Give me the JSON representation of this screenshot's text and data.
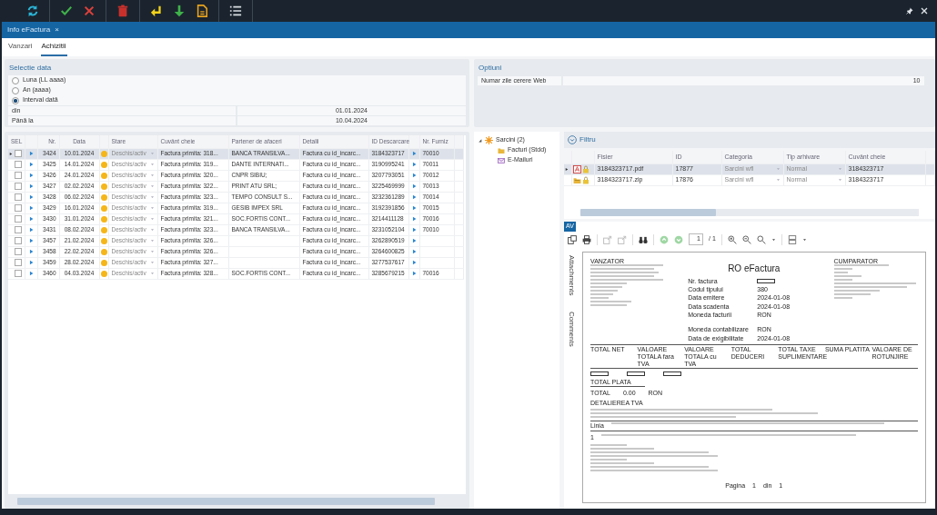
{
  "toolbar": {
    "groups": [
      [
        {
          "kind": "refresh"
        }
      ],
      [
        {
          "kind": "confirm"
        },
        {
          "kind": "cancel"
        }
      ],
      [
        {
          "kind": "delete"
        }
      ],
      [
        {
          "kind": "enter"
        },
        {
          "kind": "download"
        },
        {
          "kind": "document"
        }
      ],
      [
        {
          "kind": "list"
        }
      ]
    ]
  },
  "window_controls": [
    {
      "kind": "pin"
    },
    {
      "kind": "close"
    }
  ],
  "window": {
    "title": "Info eFactura",
    "close": "×"
  },
  "tabs": [
    {
      "label": "Vanzari",
      "selected": false
    },
    {
      "label": "Achizitii",
      "selected": true
    }
  ],
  "date_selection": {
    "title": "Selectie data",
    "options": [
      {
        "label": "Luna (LL aaaa)",
        "selected": false
      },
      {
        "label": "An (aaaa)",
        "selected": false
      },
      {
        "label": "Interval dată",
        "selected": true
      }
    ],
    "fields": [
      {
        "label": "din",
        "value": "01.01.2024"
      },
      {
        "label": "Până la",
        "value": "10.04.2024"
      }
    ]
  },
  "options": {
    "title": "Optiuni",
    "fields": [
      {
        "label": "Numar zile cerere Web",
        "value": "10"
      }
    ]
  },
  "invoices": {
    "columns": [
      "SEL",
      "Nr.",
      "Data",
      "Stare",
      "Cuvânt cheie",
      "Partener de afaceri",
      "Detalii",
      "ID Descarcare",
      "Nr. Furniz"
    ],
    "rows": [
      {
        "selected": true,
        "checked": false,
        "nr": "3424",
        "date": "10.01.2024",
        "status": "Deschis/activ",
        "keyword": "Factura primita: 318...",
        "partner": "BANCA TRANSILVA...",
        "details": "Factura cu id_incarc...",
        "download_id": "3184323717",
        "supplier_nr": "70010"
      },
      {
        "selected": false,
        "checked": false,
        "nr": "3425",
        "date": "14.01.2024",
        "status": "Deschis/activ",
        "keyword": "Factura primita: 319...",
        "partner": "DANTE INTERNATI...",
        "details": "Factura cu id_incarc...",
        "download_id": "3190995241",
        "supplier_nr": "70011"
      },
      {
        "selected": false,
        "checked": false,
        "nr": "3426",
        "date": "24.01.2024",
        "status": "Deschis/activ",
        "keyword": "Factura primita: 320...",
        "partner": "CNPR SIBIU;",
        "details": "Factura cu id_incarc...",
        "download_id": "3207793051",
        "supplier_nr": "70012"
      },
      {
        "selected": false,
        "checked": false,
        "nr": "3427",
        "date": "02.02.2024",
        "status": "Deschis/activ",
        "keyword": "Factura primita: 322...",
        "partner": "PRINT ATU SRL;",
        "details": "Factura cu id_incarc...",
        "download_id": "3225469999",
        "supplier_nr": "70013"
      },
      {
        "selected": false,
        "checked": false,
        "nr": "3428",
        "date": "06.02.2024",
        "status": "Deschis/activ",
        "keyword": "Factura primita: 323...",
        "partner": "TEMPO CONSULT S...",
        "details": "Factura cu id_incarc...",
        "download_id": "3232361289",
        "supplier_nr": "70014"
      },
      {
        "selected": false,
        "checked": false,
        "nr": "3429",
        "date": "16.01.2024",
        "status": "Deschis/activ",
        "keyword": "Factura primita: 319...",
        "partner": "GESIB IMPEX SRL",
        "details": "Factura cu id_incarc...",
        "download_id": "3192391856",
        "supplier_nr": "70015"
      },
      {
        "selected": false,
        "checked": false,
        "nr": "3430",
        "date": "31.01.2024",
        "status": "Deschis/activ",
        "keyword": "Factura primita: 321...",
        "partner": "SOC.FORTIS CONT...",
        "details": "Factura cu id_incarc...",
        "download_id": "3214411128",
        "supplier_nr": "70016"
      },
      {
        "selected": false,
        "checked": false,
        "nr": "3431",
        "date": "08.02.2024",
        "status": "Deschis/activ",
        "keyword": "Factura primita: 323...",
        "partner": "BANCA TRANSILVA...",
        "details": "Factura cu id_incarc...",
        "download_id": "3231052104",
        "supplier_nr": "70010"
      },
      {
        "selected": false,
        "checked": false,
        "nr": "3457",
        "date": "21.02.2024",
        "status": "Deschis/activ",
        "keyword": "Factura primita: 326...",
        "details": "Factura cu id_incarc...",
        "download_id": "3262890519"
      },
      {
        "selected": false,
        "checked": false,
        "nr": "3458",
        "date": "22.02.2024",
        "status": "Deschis/activ",
        "keyword": "Factura primita: 326...",
        "details": "Factura cu id_incarc...",
        "download_id": "3264600825"
      },
      {
        "selected": false,
        "checked": false,
        "nr": "3459",
        "date": "28.02.2024",
        "status": "Deschis/activ",
        "keyword": "Factura primita: 327...",
        "details": "Factura cu id_incarc...",
        "download_id": "3277537617"
      },
      {
        "selected": false,
        "checked": false,
        "nr": "3460",
        "date": "04.03.2024",
        "status": "Deschis/activ",
        "keyword": "Factura primita: 328...",
        "partner": "SOC.FORTIS CONT...",
        "details": "Factura cu id_incarc...",
        "download_id": "3285679215",
        "supplier_nr": "70016"
      }
    ]
  },
  "tree": [
    {
      "label": "Sarcini (2)",
      "kind": "tasks",
      "expanded": true,
      "children": [
        {
          "label": "Facturi (Stdd)",
          "kind": "folder"
        },
        {
          "label": "E-Mailuri",
          "kind": "mail"
        }
      ]
    }
  ],
  "filter": {
    "title": "Filtru"
  },
  "files": {
    "columns": [
      "Fisier",
      "ID",
      "Categoria",
      "Tip arhivare",
      "Cuvânt cheie"
    ],
    "rows": [
      {
        "selected": true,
        "kind": "pdf",
        "name": "3184323717.pdf",
        "id": "17877",
        "category": "Sarcini wfl",
        "archive_type": "Normal",
        "keyword": "3184323717"
      },
      {
        "selected": false,
        "kind": "zip",
        "name": "3184323717.zip",
        "id": "17876",
        "category": "Sarcini wfl",
        "archive_type": "Normal",
        "keyword": "3184323717"
      }
    ]
  },
  "viewer": {
    "badge": "AV",
    "page": "1",
    "page_count": "/ 1",
    "side_tabs": [
      "Attachments",
      "Comments"
    ],
    "document": {
      "title": "RO eFactura",
      "seller_heading": "VANZATOR",
      "buyer_heading": "CUMPARATOR",
      "invoice_fields": [
        {
          "label": "Nr. factura",
          "kind": "box"
        },
        {
          "label": "Codul tipului",
          "value": "380"
        },
        {
          "label": "Data emitere",
          "value": "2024-01-08"
        },
        {
          "label": "Data scadenta",
          "value": "2024-01-08"
        },
        {
          "label": "Moneda facturii",
          "value": "RON"
        }
      ],
      "accounting_fields": [
        {
          "label": "Moneda contabilizare",
          "value": "RON"
        },
        {
          "label": "Data de exigibilitate",
          "value": "2024-01-08"
        }
      ],
      "total_headings": [
        "TOTAL NET",
        "VALOARE TOTALA fara TVA",
        "VALOARE TOTALA cu TVA",
        "TOTAL DEDUCERI",
        "TOTAL TAXE SUPLIMENTARE",
        "SUMA PLATITA",
        "VALOARE DE ROTUNJIRE"
      ],
      "total_payable": "TOTAL PLATA",
      "total": {
        "label": "TOTAL",
        "amount": "0.00",
        "currency": "RON"
      },
      "vat_heading": "DETALIEREA TVA",
      "line_heading": "Linia",
      "line_nr": "1",
      "footer": {
        "label": "Pagina",
        "page": "1",
        "of": "din",
        "pages": "1"
      }
    }
  }
}
